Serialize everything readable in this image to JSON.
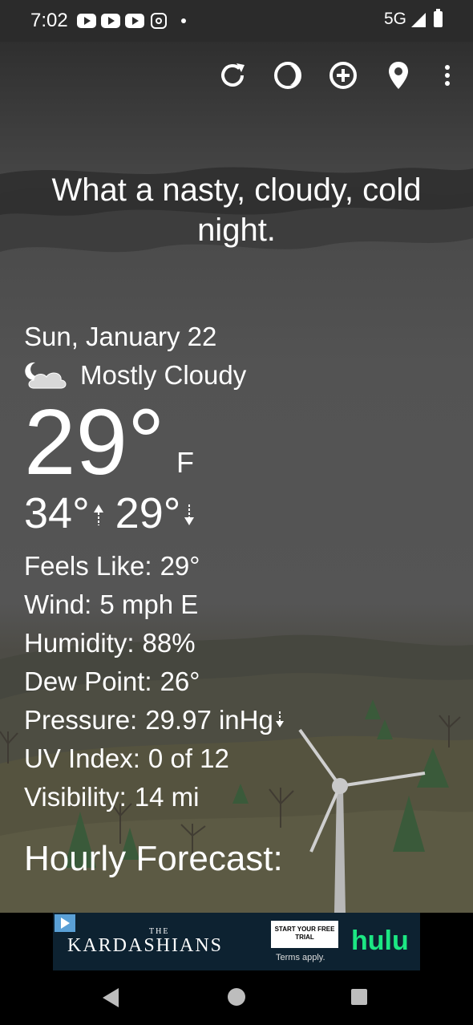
{
  "status_bar": {
    "time": "7:02",
    "network": "5G",
    "notification_icons": [
      "youtube-icon",
      "youtube-icon",
      "youtube-icon",
      "instagram-icon"
    ]
  },
  "toolbar": {
    "icons": [
      "refresh-icon",
      "theme-icon",
      "add-location-icon",
      "location-pin-icon",
      "more-vert-icon"
    ]
  },
  "headline": "What a nasty, cloudy, cold night.",
  "weather": {
    "date": "Sun, January 22",
    "condition": "Mostly Cloudy",
    "condition_icon": "partly-cloudy-night-icon",
    "temperature": "29°",
    "unit": "F",
    "high": "34°",
    "low": "29°",
    "details": [
      {
        "label": "Feels Like:",
        "value": "29°"
      },
      {
        "label": "Wind:",
        "value": "5 mph E"
      },
      {
        "label": "Humidity:",
        "value": "88%"
      },
      {
        "label": "Dew Point:",
        "value": "26°"
      },
      {
        "label": "Pressure:",
        "value": "29.97 inHg"
      },
      {
        "label": "UV Index:",
        "value": "0 of 12"
      },
      {
        "label": "Visibility:",
        "value": "14 mi"
      }
    ],
    "pressure_trend": "falling",
    "hourly_heading": "Hourly Forecast:"
  },
  "ad": {
    "title_small": "THE",
    "title": "KARDASHIANS",
    "cta": "START YOUR FREE TRIAL",
    "terms": "Terms apply.",
    "brand": "hulu",
    "brand_color": "#1ce783"
  },
  "nav": {
    "icons": [
      "back-icon",
      "home-icon",
      "recents-icon"
    ]
  }
}
